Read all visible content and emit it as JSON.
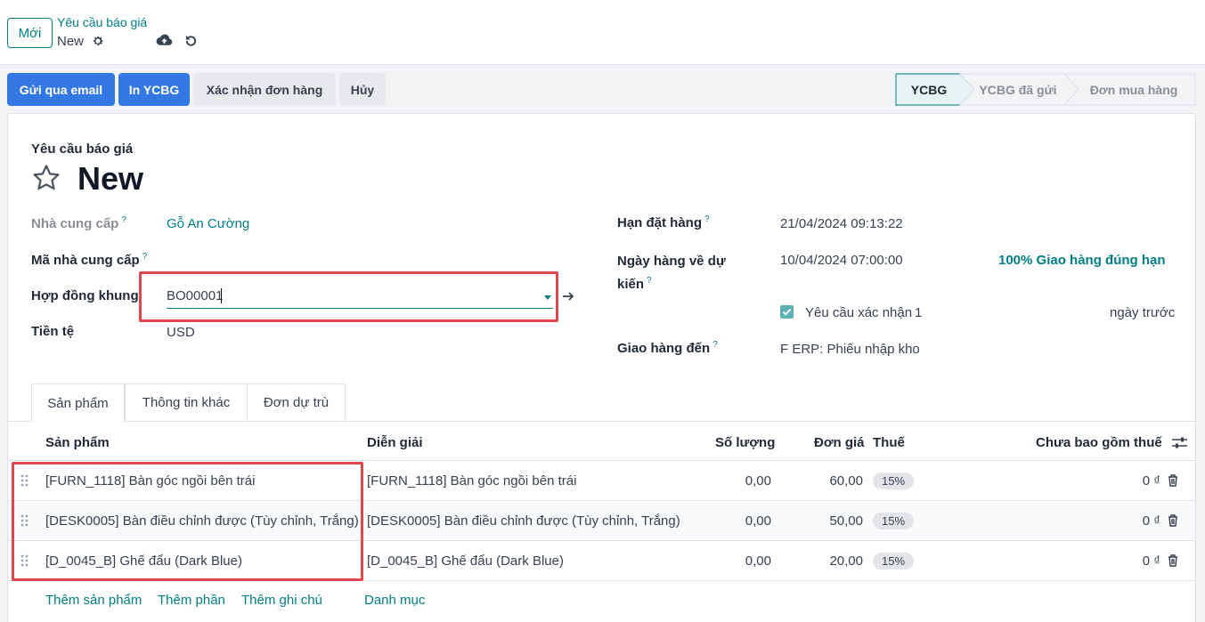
{
  "topbar": {
    "new_button": "Mới",
    "breadcrumb_parent": "Yêu cầu báo giá",
    "breadcrumb_current": "New"
  },
  "actions": {
    "send_email": "Gửi qua email",
    "print": "In YCBG",
    "confirm": "Xác nhận đơn hàng",
    "cancel": "Hủy"
  },
  "status": {
    "stages": [
      "YCBG",
      "YCBG đã gửi",
      "Đơn mua hàng"
    ],
    "active": "YCBG"
  },
  "form": {
    "doc_type": "Yêu cầu báo giá",
    "title": "New",
    "vendor_label": "Nhà cung cấp",
    "vendor_value": "Gỗ An Cường",
    "vendor_ref_label": "Mã nhà cung cấp",
    "agreement_label": "Hợp đồng khung",
    "agreement_value": "BO00001",
    "currency_label": "Tiền tệ",
    "currency_value": "USD",
    "deadline_label": "Hạn đặt hàng",
    "deadline_value": "21/04/2024 09:13:22",
    "expected_label_1": "Ngày hàng về dự",
    "expected_label_2": "kiến",
    "expected_value": "10/04/2024 07:00:00",
    "on_time": "100% Giao hàng đúng hạn",
    "ask_confirm_label": "Yêu cầu xác nhận",
    "ask_confirm_days": "1",
    "days_before": "ngày trước",
    "deliver_to_label": "Giao hàng đến",
    "deliver_to_value": "F ERP: Phiếu nhập kho",
    "help_mark": "?"
  },
  "tabs": [
    "Sản phẩm",
    "Thông tin khác",
    "Đơn dự trù"
  ],
  "table": {
    "headers": {
      "product": "Sản phẩm",
      "description": "Diễn giải",
      "qty": "Số lượng",
      "price": "Đơn giá",
      "tax": "Thuế",
      "subtotal": "Chưa bao gồm thuế"
    },
    "rows": [
      {
        "product": "[FURN_1118] Bàn góc ngồi bên trái",
        "description": "[FURN_1118] Bàn góc ngồi bên trái",
        "qty": "0,00",
        "price": "60,00",
        "tax": "15%",
        "subtotal": "0 ₫"
      },
      {
        "product": "[DESK0005] Bàn điều chỉnh được (Tùy chỉnh, Trắng)",
        "description": "[DESK0005] Bàn điều chỉnh được (Tùy chỉnh, Trắng)",
        "qty": "0,00",
        "price": "50,00",
        "tax": "15%",
        "subtotal": "0 ₫"
      },
      {
        "product": "[D_0045_B] Ghế đẩu (Dark Blue)",
        "description": "[D_0045_B] Ghế đẩu (Dark Blue)",
        "qty": "0,00",
        "price": "20,00",
        "tax": "15%",
        "subtotal": "0 ₫"
      }
    ],
    "add_product": "Thêm sản phẩm",
    "add_section": "Thêm phần",
    "add_note": "Thêm ghi chú",
    "catalog": "Danh mục"
  },
  "colors": {
    "primary": "#3478e5",
    "teal": "#017e84",
    "highlight": "#e0474c"
  }
}
